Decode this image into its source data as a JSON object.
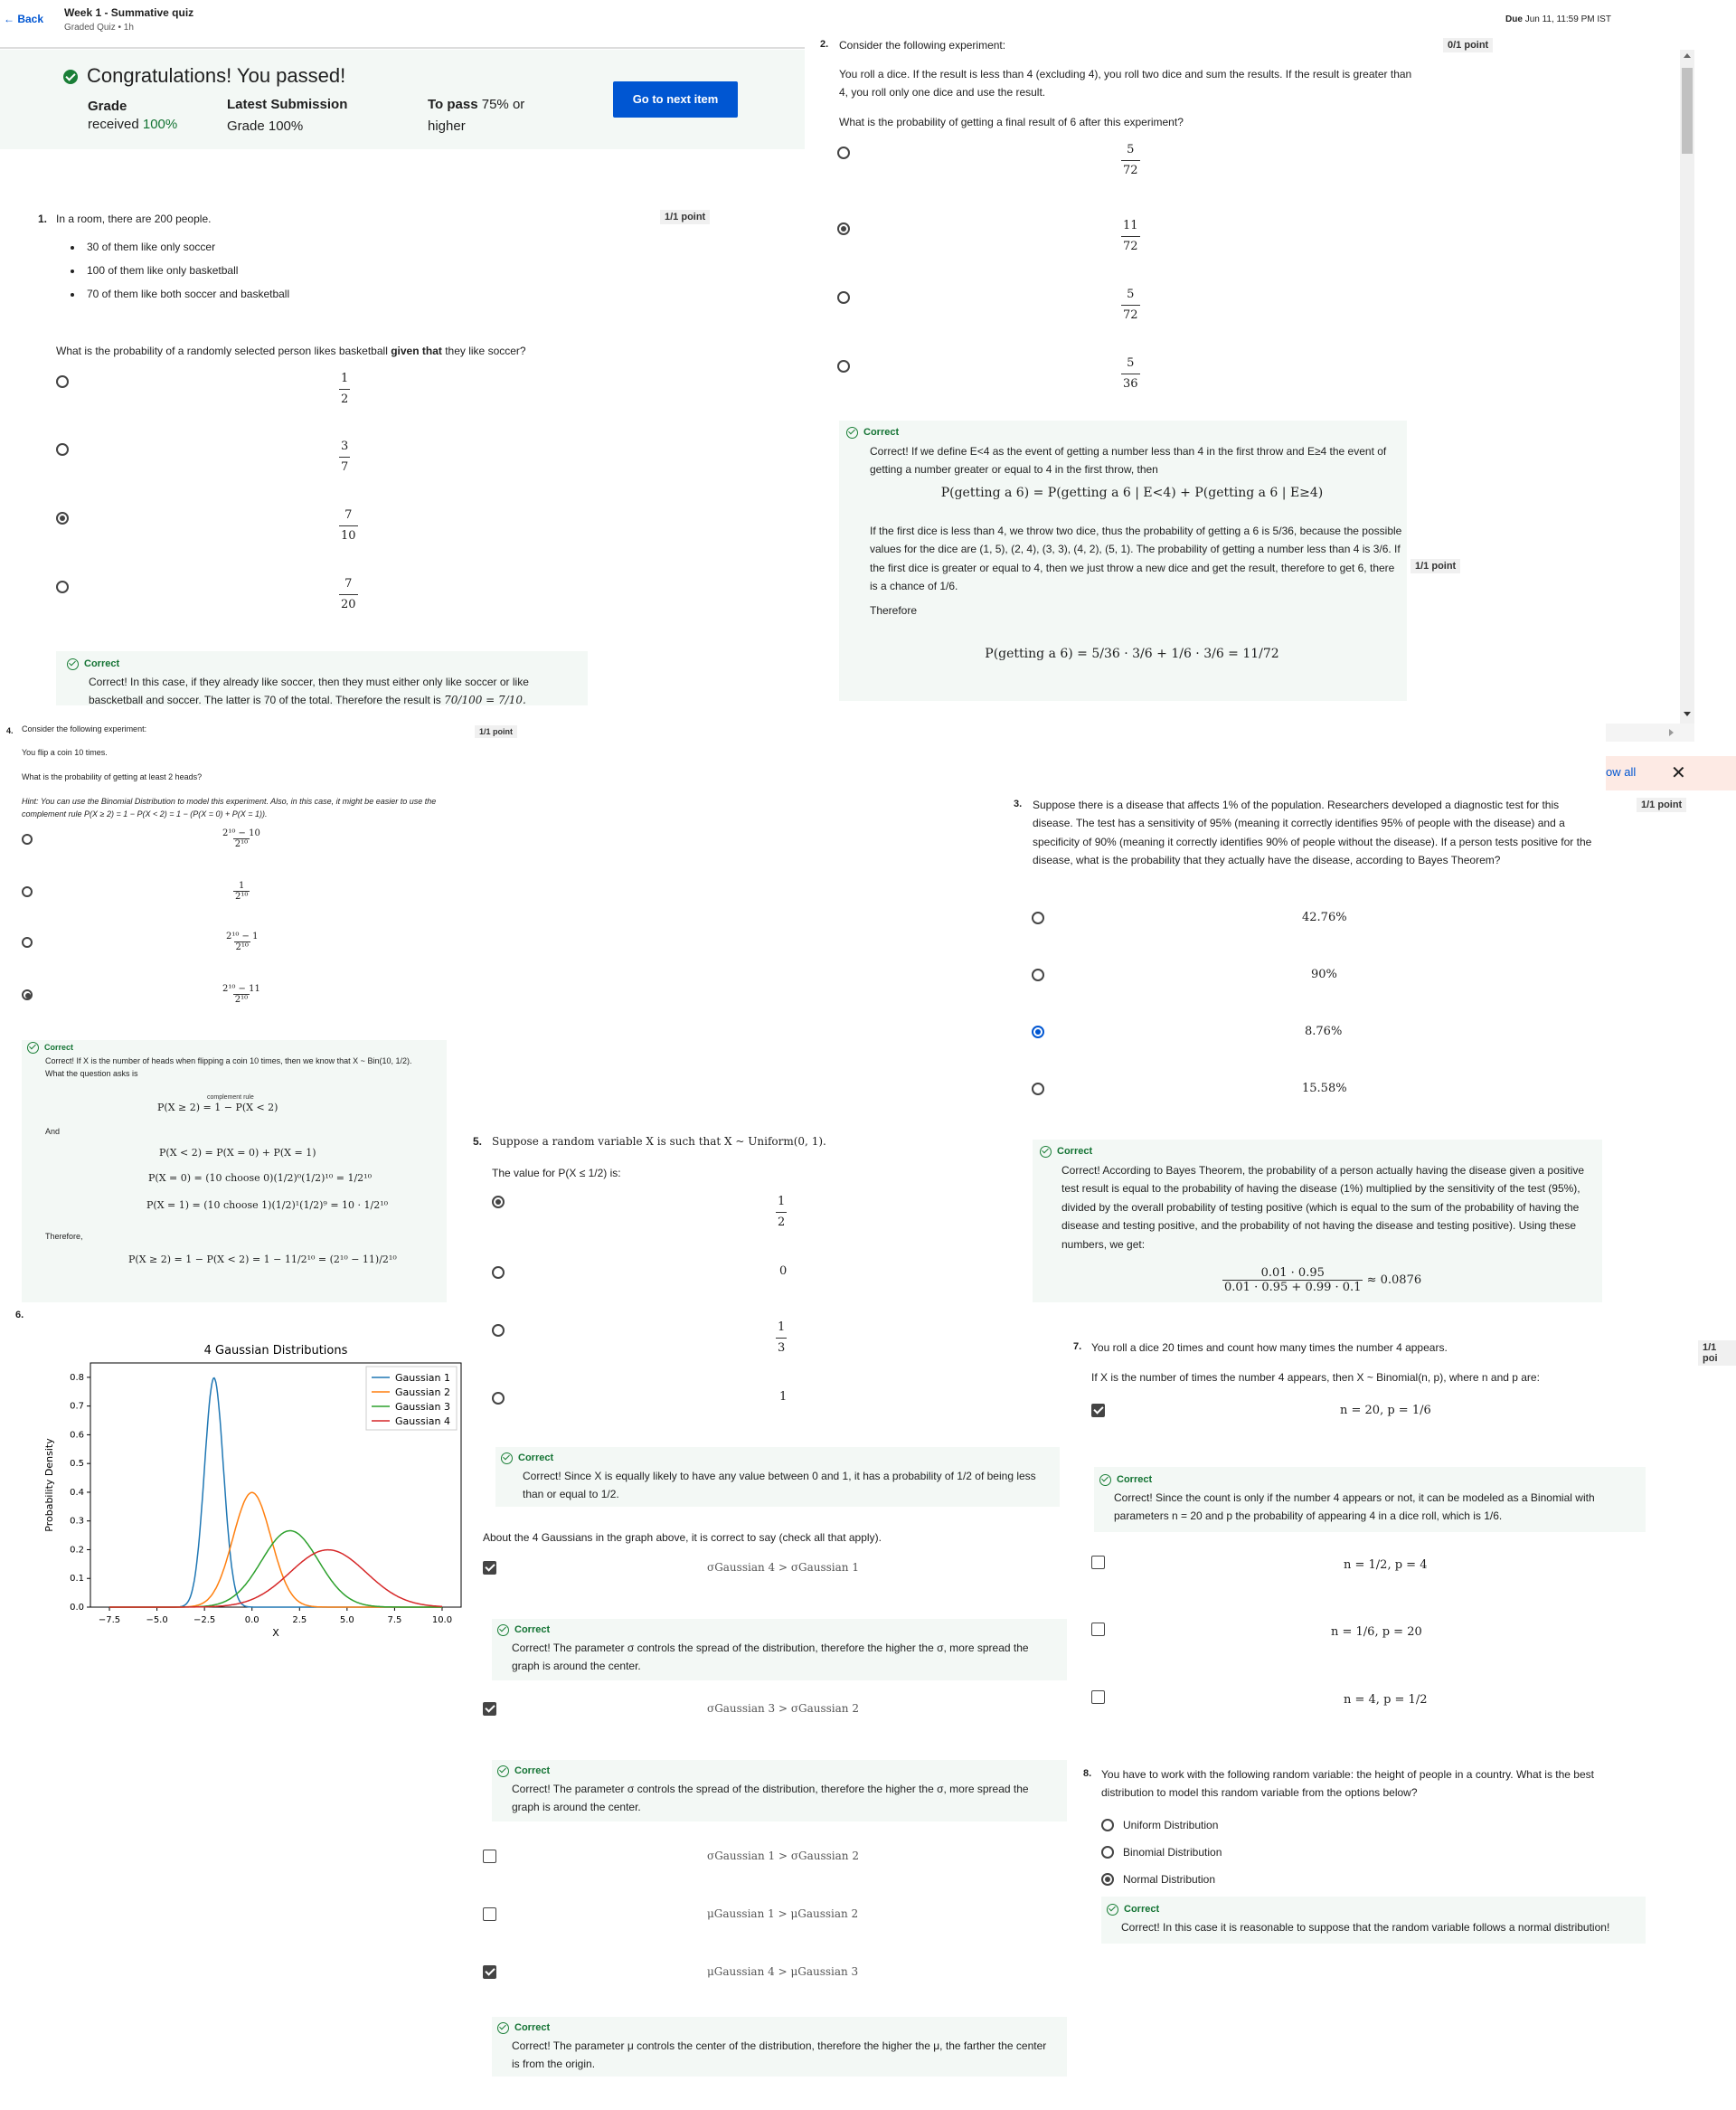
{
  "header": {
    "back": "Back",
    "title": "Week 1 - Summative quiz",
    "subtitle": "Graded Quiz • 1h",
    "due_label": "Due",
    "due": "Jun 11, 11:59 PM IST"
  },
  "result": {
    "title": "Congratulations! You passed!",
    "grade_label": "Grade",
    "grade_received": "received",
    "grade_value": "100%",
    "latest_label": "Latest Submission",
    "latest_grade": "Grade 100%",
    "pass_label": "To pass",
    "pass_value": "75% or",
    "pass_value2": "higher",
    "next_button": "Go to next item"
  },
  "q1": {
    "num": "1.",
    "text": "In a room, there are 200 people.",
    "bullets": [
      "30 of them like only soccer",
      "100 of them like only basketball",
      "70 of them like both soccer and basketball"
    ],
    "question_a": "What is the probability of a randomly selected person likes basketball ",
    "question_b": "given that",
    "question_c": " they like soccer?",
    "points": "1/1 point",
    "options": [
      {
        "n": "1",
        "d": "2"
      },
      {
        "n": "3",
        "d": "7"
      },
      {
        "n": "7",
        "d": "10"
      },
      {
        "n": "7",
        "d": "20"
      }
    ],
    "selected": 2,
    "fb_title": "Correct",
    "fb_text": "Correct! In this case, if they already like soccer, then they must either only like soccer or like bascketball and soccer. The latter is 70 of the total. Therefore the result is",
    "fb_math": "70/100 = 7/10."
  },
  "q2": {
    "num": "2.",
    "text": "Consider the following experiment:",
    "points": "0/1 point",
    "desc": "You roll a dice. If the result is less than 4 (excluding 4), you roll two dice and sum the results. If the result is greater than 4, you roll only one dice and use the result.",
    "question": "What is the probability of getting a final result of 6 after this experiment?",
    "options": [
      {
        "n": "5",
        "d": "72"
      },
      {
        "n": "11",
        "d": "72"
      },
      {
        "n": "5",
        "d": "72"
      },
      {
        "n": "5",
        "d": "36"
      }
    ],
    "selected": 1,
    "fb_title": "Correct",
    "fb_text1": "Correct! If we define E<4 as the event of getting a number less than 4 in the first throw and E≥4 the event of getting a number greater or equal to 4 in the first throw, then",
    "fb_eq1": "P(getting a 6) = P(getting a 6 | E<4) + P(getting a 6 | E≥4)",
    "fb_text2": "If the first dice is less than 4, we throw two dice, thus the probability of getting a 6 is 5/36, because the possible values for the dice are (1, 5), (2, 4), (3, 3), (4, 2), (5, 1). The probability of getting a number less than 4 is 3/6. If the first dice is greater or equal to 4, then we just throw a new dice and get the result, therefore to get 6, there is a chance of 1/6.",
    "fb_text3": "Therefore",
    "fb_eq2": "P(getting a 6) = 5/36 · 3/6 + 1/6 · 3/6 = 11/72",
    "side_points": "1/1 point"
  },
  "q3": {
    "num": "3.",
    "text": "Suppose there is a disease that affects 1% of the population. Researchers developed a diagnostic test for this disease. The test has a sensitivity of 95% (meaning it correctly identifies 95% of people with the disease) and a specificity of 90% (meaning it correctly identifies 90% of people without the disease). If a person tests positive for the disease, what is the probability that they actually have the disease, according to Bayes Theorem?",
    "points": "1/1 point",
    "options": [
      "42.76%",
      "90%",
      "8.76%",
      "15.58%"
    ],
    "selected": 2,
    "fb_title": "Correct",
    "fb_text": "Correct!  According to Bayes Theorem, the probability of a person actually having the disease given a positive test result is equal to the probability of having the disease (1%) multiplied by the sensitivity of the test (95%), divided by the overall probability of testing positive (which is equal to the sum of the probability of having the disease and testing positive, and the probability of not having the disease and testing positive). Using these numbers, we get:",
    "fb_num": "0.01 · 0.95",
    "fb_den": "0.01 · 0.95 + 0.99 · 0.1",
    "fb_res": "≈ 0.0876",
    "show_all": "ow all"
  },
  "q4": {
    "num": "4.",
    "text": "Consider the following experiment:",
    "points": "1/1 point",
    "desc": "You flip a coin 10 times.",
    "question": "What is the probability of getting at least 2 heads?",
    "hint": "Hint: You can use the Binomial Distribution to model this experiment. Also, in this case, it might be easier to use the complement rule P(X ≥ 2) = 1 − P(X < 2) = 1 − (P(X = 0) + P(X = 1)).",
    "options": [
      {
        "n": "2¹⁰ − 10",
        "d": "2¹⁰"
      },
      {
        "n": "1",
        "d": "2¹⁰"
      },
      {
        "n": "2¹⁰ − 1",
        "d": "2¹⁰"
      },
      {
        "n": "2¹⁰ − 11",
        "d": "2¹⁰"
      }
    ],
    "selected": 3,
    "fb_title": "Correct",
    "fb_text": "Correct! If X is the number of heads when flipping a coin 10 times, then we know that X ~ Bin(10, 1/2). What the question asks is",
    "fb_eq1": "P(X ≥ 2) = 1 − P(X < 2)",
    "fb_eq1_note": "complement rule",
    "fb_and": "And",
    "fb_eq2": "P(X < 2) = P(X = 0) + P(X = 1)",
    "fb_eq3": "P(X = 0) = (10 choose 0)(1/2)⁰(1/2)¹⁰ = 1/2¹⁰",
    "fb_eq4": "P(X = 1) = (10 choose 1)(1/2)¹(1/2)⁹ = 10 · 1/2¹⁰",
    "fb_therefore": "Therefore,",
    "fb_eq5": "P(X ≥ 2) = 1 − P(X < 2) = 1 − 11/2¹⁰ = (2¹⁰ − 11)/2¹⁰"
  },
  "q5": {
    "num": "5.",
    "text": "Suppose a random variable X is such that X ~ Uniform(0, 1).",
    "question": "The value for P(X ≤ 1/2) is:",
    "options": [
      {
        "n": "1",
        "d": "2"
      },
      {
        "v": "0"
      },
      {
        "n": "1",
        "d": "3"
      },
      {
        "v": "1"
      }
    ],
    "selected": 0,
    "fb_title": "Correct",
    "fb_text": "Correct! Since X is equally likely to have any value between 0 and 1, it has a probability of 1/2 of being less than or equal to 1/2."
  },
  "q6": {
    "num": "6.",
    "question": "About the 4 Gaussians in the graph above, it is correct to say (check all that apply).",
    "options": [
      {
        "label": "σGaussian 4 > σGaussian 1",
        "checked": true,
        "fb": "Correct! The parameter σ controls the spread of the distribution, therefore the higher the σ, more spread the graph is around the center."
      },
      {
        "label": "σGaussian 3 > σGaussian 2",
        "checked": true,
        "fb": "Correct! The parameter σ controls the spread of the distribution, therefore the higher the σ, more spread the graph is around the center."
      },
      {
        "label": "σGaussian 1 > σGaussian 2",
        "checked": false,
        "fb": ""
      },
      {
        "label": "μGaussian 1 > μGaussian 2",
        "checked": false,
        "fb": ""
      },
      {
        "label": "μGaussian 4 > μGaussian 3",
        "checked": true,
        "fb": "Correct! The parameter μ controls the center of the distribution, therefore the higher the μ, the farther the center is from the origin."
      }
    ],
    "fb_title": "Correct"
  },
  "q7": {
    "num": "7.",
    "text": "You roll a dice 20 times and count how many times the number 4 appears.",
    "question": "If X is the number of times the number 4 appears, then X ~ Binomial(n, p), where n and p are:",
    "points": "1/1 poi",
    "options": [
      {
        "label": "n = 20, p = 1/6",
        "checked": true
      },
      {
        "label": "n = 1/2, p = 4",
        "checked": false
      },
      {
        "label": "n = 1/6, p = 20",
        "checked": false
      },
      {
        "label": "n = 4, p = 1/2",
        "checked": false
      }
    ],
    "fb_title": "Correct",
    "fb_text": "Correct! Since the count is only if the number 4 appears or not, it can be modeled as a Binomial with parameters n = 20 and p the probability of appearing 4 in a dice roll, which is 1/6."
  },
  "q8": {
    "num": "8.",
    "text": "You have to work with the following random variable: the height of people in a country. What is the best distribution to model this random variable from the options below?",
    "options": [
      "Uniform Distribution",
      "Binomial Distribution",
      "Normal Distribution"
    ],
    "selected": 2,
    "fb_title": "Correct",
    "fb_text": "Correct! In this case it is reasonable to suppose that the random variable follows a normal distribution!"
  },
  "chart_data": {
    "type": "line",
    "title": "4 Gaussian Distributions",
    "xlabel": "X",
    "ylabel": "Probability Density",
    "xlim": [
      -8.5,
      11
    ],
    "ylim": [
      0,
      0.85
    ],
    "xticks": [
      "−7.5",
      "−5.0",
      "−2.5",
      "0.0",
      "2.5",
      "5.0",
      "7.5",
      "10.0"
    ],
    "yticks": [
      "0.0",
      "0.1",
      "0.2",
      "0.3",
      "0.4",
      "0.5",
      "0.6",
      "0.7",
      "0.8"
    ],
    "series": [
      {
        "name": "Gaussian 1",
        "color": "#1f77b4",
        "mu": -2,
        "sigma": 0.5
      },
      {
        "name": "Gaussian 2",
        "color": "#ff7f0e",
        "mu": 0,
        "sigma": 1
      },
      {
        "name": "Gaussian 3",
        "color": "#2ca02c",
        "mu": 2,
        "sigma": 1.5
      },
      {
        "name": "Gaussian 4",
        "color": "#d62728",
        "mu": 4,
        "sigma": 2
      }
    ],
    "legend": "top-right"
  }
}
